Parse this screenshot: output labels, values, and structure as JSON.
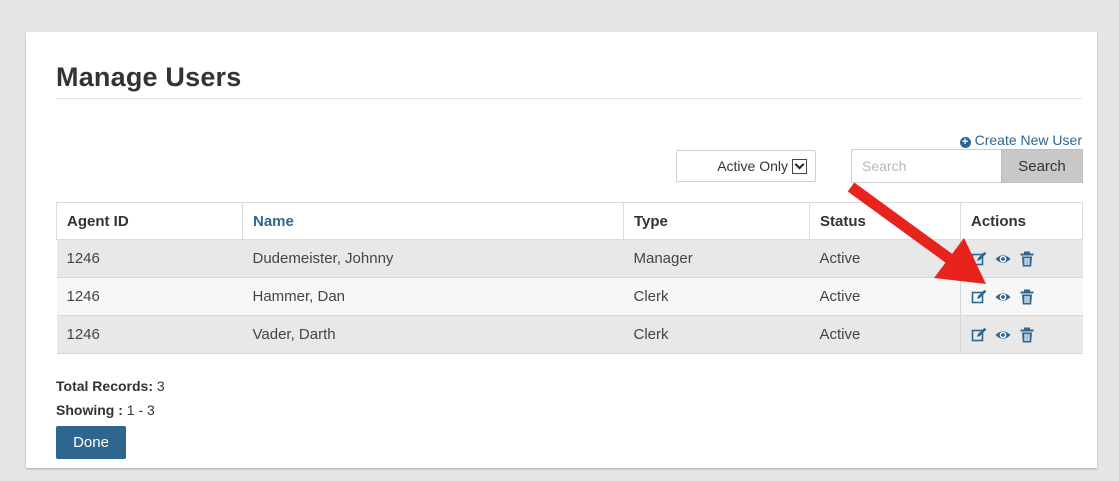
{
  "page": {
    "title": "Manage Users"
  },
  "toolbar": {
    "create_label": "Create New User",
    "filter_value": "Active Only",
    "search_placeholder": "Search",
    "search_button": "Search"
  },
  "table": {
    "headers": [
      "Agent ID",
      "Name",
      "Type",
      "Status",
      "Actions"
    ],
    "rows": [
      {
        "agent_id": "1246",
        "name": "Dudemeister, Johnny",
        "type": "Manager",
        "status": "Active"
      },
      {
        "agent_id": "1246",
        "name": "Hammer, Dan",
        "type": "Clerk",
        "status": "Active"
      },
      {
        "agent_id": "1246",
        "name": "Vader, Darth",
        "type": "Clerk",
        "status": "Active"
      }
    ]
  },
  "footer": {
    "total_label": "Total Records:",
    "total_value": "3",
    "showing_label": "Showing :",
    "showing_value": "1 - 3",
    "done_label": "Done"
  },
  "icons": [
    "plus-circle-icon",
    "chevron-down-icon",
    "edit-icon",
    "view-icon",
    "delete-icon",
    "annotation-arrow"
  ],
  "colors": {
    "accent": "#2f6690",
    "annotation": "#e8221c"
  }
}
